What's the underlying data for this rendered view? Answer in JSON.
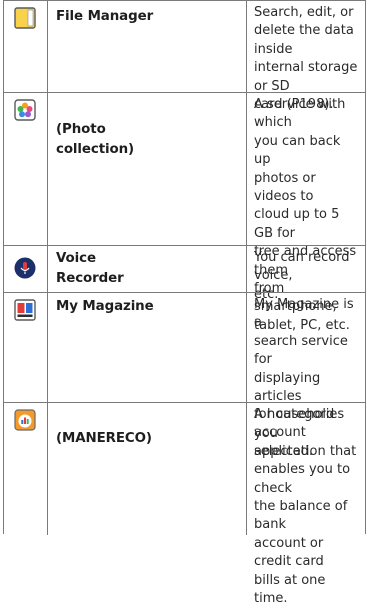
{
  "rows": [
    {
      "icon": "file-manager-icon",
      "name": "File Manager",
      "description_lines": [
        "Search, edit, or",
        "delete the data inside",
        "internal storage or SD",
        "card (P198)."
      ]
    },
    {
      "icon": "photo-collection-icon",
      "name_lines": [
        "(Photo",
        "collection)"
      ],
      "description_lines": [
        "A service with which",
        "you can back up",
        "photos or videos to",
        "cloud up to 5 GB for",
        "free and access them",
        "from smartphone,",
        "tablet, PC, etc."
      ]
    },
    {
      "icon": "voice-recorder-icon",
      "name_lines": [
        "Voice",
        "Recorder"
      ],
      "description_lines": [
        "You can record voice,",
        "etc."
      ]
    },
    {
      "icon": "my-magazine-icon",
      "name": "My Magazine",
      "description_lines": [
        "My Magazine is a",
        "search service for",
        "displaying articles",
        "for categories you",
        "selected."
      ]
    },
    {
      "icon": "manereco-icon",
      "name": "(MANERECO)",
      "description_lines": [
        "A household account",
        "application that",
        "enables you to check",
        "the balance of bank",
        "account or credit card",
        "bills at one time."
      ]
    }
  ]
}
